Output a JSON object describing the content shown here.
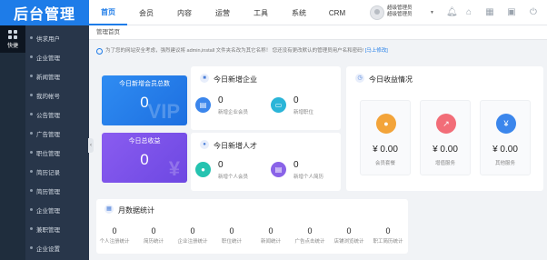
{
  "brand": "后台管理",
  "strip": {
    "quick_label": "快捷"
  },
  "sidebar": {
    "items": [
      {
        "label": "供求用户"
      },
      {
        "label": "企业管理"
      },
      {
        "label": "新闻管理"
      },
      {
        "label": "我的帐号"
      },
      {
        "label": "公告管理"
      },
      {
        "label": "广告管理"
      },
      {
        "label": "职位管理"
      },
      {
        "label": "简历记录"
      },
      {
        "label": "简历管理"
      },
      {
        "label": "企业管理"
      },
      {
        "label": "兼职管理"
      },
      {
        "label": "企业设置"
      }
    ]
  },
  "header": {
    "nav": [
      {
        "label": "首页"
      },
      {
        "label": "会员"
      },
      {
        "label": "内容"
      },
      {
        "label": "运营"
      },
      {
        "label": "工具"
      },
      {
        "label": "系统"
      },
      {
        "label": "CRM"
      }
    ],
    "user_line1": "超级管理员",
    "user_line2": "超级管理员"
  },
  "breadcrumb": "管理首页",
  "notice": {
    "text": "为了您的网站安全考虑，强烈建议将 admin,install 文件夹名改为其它名称！ 您还没有更改默认的管理员用户名和密码!",
    "link": "[马上修改]"
  },
  "cards": {
    "members_total": {
      "title": "今日新增会员总数",
      "value": "0"
    },
    "income_total": {
      "title": "今日总收益",
      "value": "0"
    }
  },
  "new_companies": {
    "title": "今日新增企业",
    "items": [
      {
        "value": "0",
        "label": "新增企业会员"
      },
      {
        "value": "0",
        "label": "新增职位"
      }
    ]
  },
  "new_talents": {
    "title": "今日新增人才",
    "items": [
      {
        "value": "0",
        "label": "新增个人会员"
      },
      {
        "value": "0",
        "label": "新增个人简历"
      }
    ]
  },
  "earnings": {
    "title": "今日收益情况",
    "items": [
      {
        "value": "¥ 0.00",
        "label": "会员套餐"
      },
      {
        "value": "¥ 0.00",
        "label": "增值服务"
      },
      {
        "value": "¥ 0.00",
        "label": "其他服务"
      }
    ]
  },
  "monthly": {
    "title": "月数据统计",
    "items": [
      {
        "value": "0",
        "label": "个人注册统计"
      },
      {
        "value": "0",
        "label": "简历统计"
      },
      {
        "value": "0",
        "label": "企业注册统计"
      },
      {
        "value": "0",
        "label": "职位统计"
      },
      {
        "value": "0",
        "label": "新闻统计"
      },
      {
        "value": "0",
        "label": "广告点击统计"
      },
      {
        "value": "0",
        "label": "店铺浏览统计"
      },
      {
        "value": "0",
        "label": "职工简历统计"
      }
    ]
  },
  "colors": {
    "accent": "#1e7ce8",
    "sidebar_bg": "#28364a",
    "blue_card": "#2f8cf2",
    "purple_card": "#8a5cf0"
  }
}
